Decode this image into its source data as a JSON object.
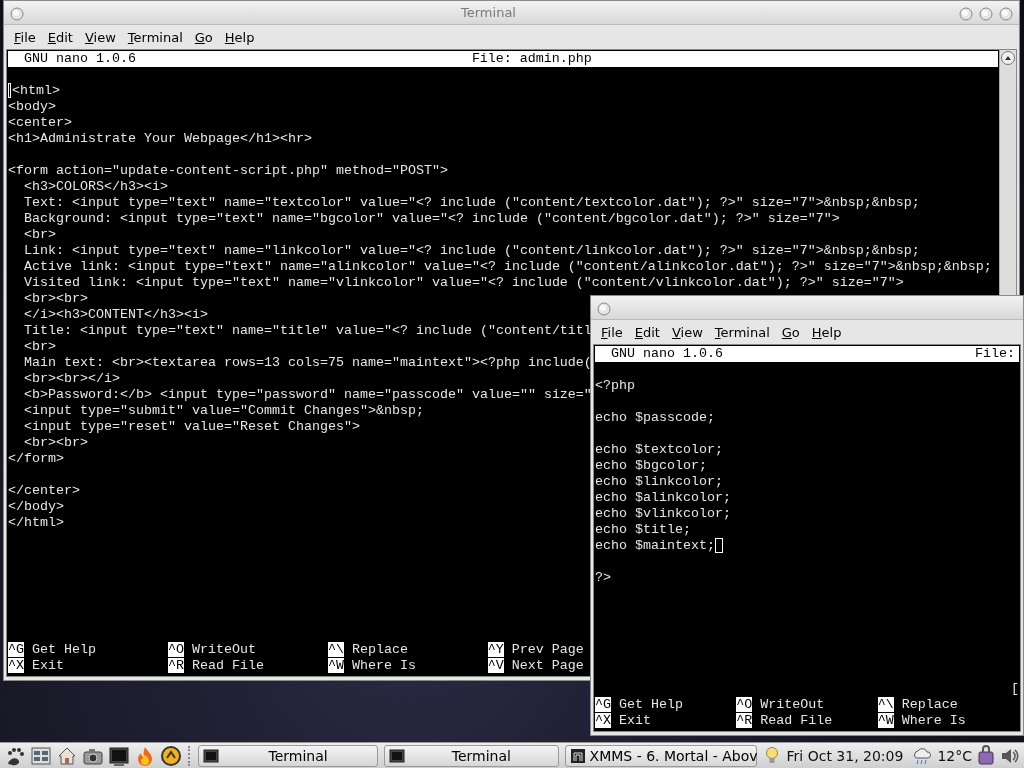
{
  "windows": [
    {
      "title": "Terminal",
      "menu": [
        "File",
        "Edit",
        "View",
        "Terminal",
        "Go",
        "Help"
      ],
      "nano": {
        "version": "GNU nano 1.0.6",
        "file": "File: admin.php",
        "blocks": [
          [
            "<html>",
            "<body>",
            "<center>",
            "<h1>Administrate Your Webpage</h1><hr>"
          ],
          [
            "<form action=\"update-content-script.php\" method=\"POST\">",
            "  <h3>COLORS</h3><i>",
            "  Text: <input type=\"text\" name=\"textcolor\" value=\"<? include (\"content/textcolor.dat\"); ?>\" size=\"7\">&nbsp;&nbsp;",
            "  Background: <input type=\"text\" name=\"bgcolor\" value=\"<? include (\"content/bgcolor.dat\"); ?>\" size=\"7\">",
            "  <br>",
            "  Link: <input type=\"text\" name=\"linkcolor\" value=\"<? include (\"content/linkcolor.dat\"); ?>\" size=\"7\">&nbsp;&nbsp;",
            "  Active link: <input type=\"text\" name=\"alinkcolor\" value=\"<? include (\"content/alinkcolor.dat\"); ?>\" size=\"7\">&nbsp;&nbsp;",
            "  Visited link: <input type=\"text\" name=\"vlinkcolor\" value=\"<? include (\"content/vlinkcolor.dat\"); ?>\" size=\"7\">",
            "  <br><br>",
            "  </i><h3>CONTENT</h3><i>",
            "  Title: <input type=\"text\" name=\"title\" value=\"<? include (\"content/titl",
            "  <br>",
            "  Main text: <br><textarea rows=13 cols=75 name=\"maintext\"><?php include(",
            "  <br><br></i>",
            "  <b>Password:</b> <input type=\"password\" name=\"passcode\" value=\"\" size=\"",
            "  <input type=\"submit\" value=\"Commit Changes\">&nbsp;",
            "  <input type=\"reset\" value=\"Reset Changes\">",
            "  <br><br>",
            "</form>"
          ],
          [
            "</center>",
            "</body>",
            "</html>"
          ]
        ],
        "shortcuts": [
          [
            {
              "key": "^G",
              "label": "Get Help"
            },
            {
              "key": "^X",
              "label": "Exit"
            }
          ],
          [
            {
              "key": "^O",
              "label": "WriteOut"
            },
            {
              "key": "^R",
              "label": "Read File"
            }
          ],
          [
            {
              "key": "^\\",
              "label": "Replace"
            },
            {
              "key": "^W",
              "label": "Where Is"
            }
          ],
          [
            {
              "key": "^Y",
              "label": "Prev Page"
            },
            {
              "key": "^V",
              "label": "Next Page"
            }
          ]
        ]
      }
    },
    {
      "menu": [
        "File",
        "Edit",
        "View",
        "Terminal",
        "Go",
        "Help"
      ],
      "nano": {
        "version": "GNU nano 1.0.6",
        "file": "File:",
        "blocks": [
          [
            "<?php"
          ],
          [
            "echo $passcode;"
          ],
          [
            "echo $textcolor;",
            "echo $bgcolor;",
            "echo $linkcolor;",
            "echo $alinkcolor;",
            "echo $vlinkcolor;",
            "echo $title;",
            "echo $maintext;"
          ],
          [
            "?>"
          ]
        ],
        "status": "[",
        "shortcuts": [
          [
            {
              "key": "^G",
              "label": "Get Help"
            },
            {
              "key": "^X",
              "label": "Exit"
            }
          ],
          [
            {
              "key": "^O",
              "label": "WriteOut"
            },
            {
              "key": "^R",
              "label": "Read File"
            }
          ],
          [
            {
              "key": "^\\",
              "label": "Replace"
            },
            {
              "key": "^W",
              "label": "Where Is"
            }
          ]
        ]
      }
    }
  ],
  "taskbar": {
    "tasks": [
      {
        "kind": "terminal",
        "label": "Terminal"
      },
      {
        "kind": "terminal",
        "label": "Terminal"
      },
      {
        "kind": "xmms",
        "label": "XMMS - 6. Mortal - Abov"
      }
    ],
    "clock": "Fri Oct 31, 20:09",
    "temperature": "12°C"
  }
}
